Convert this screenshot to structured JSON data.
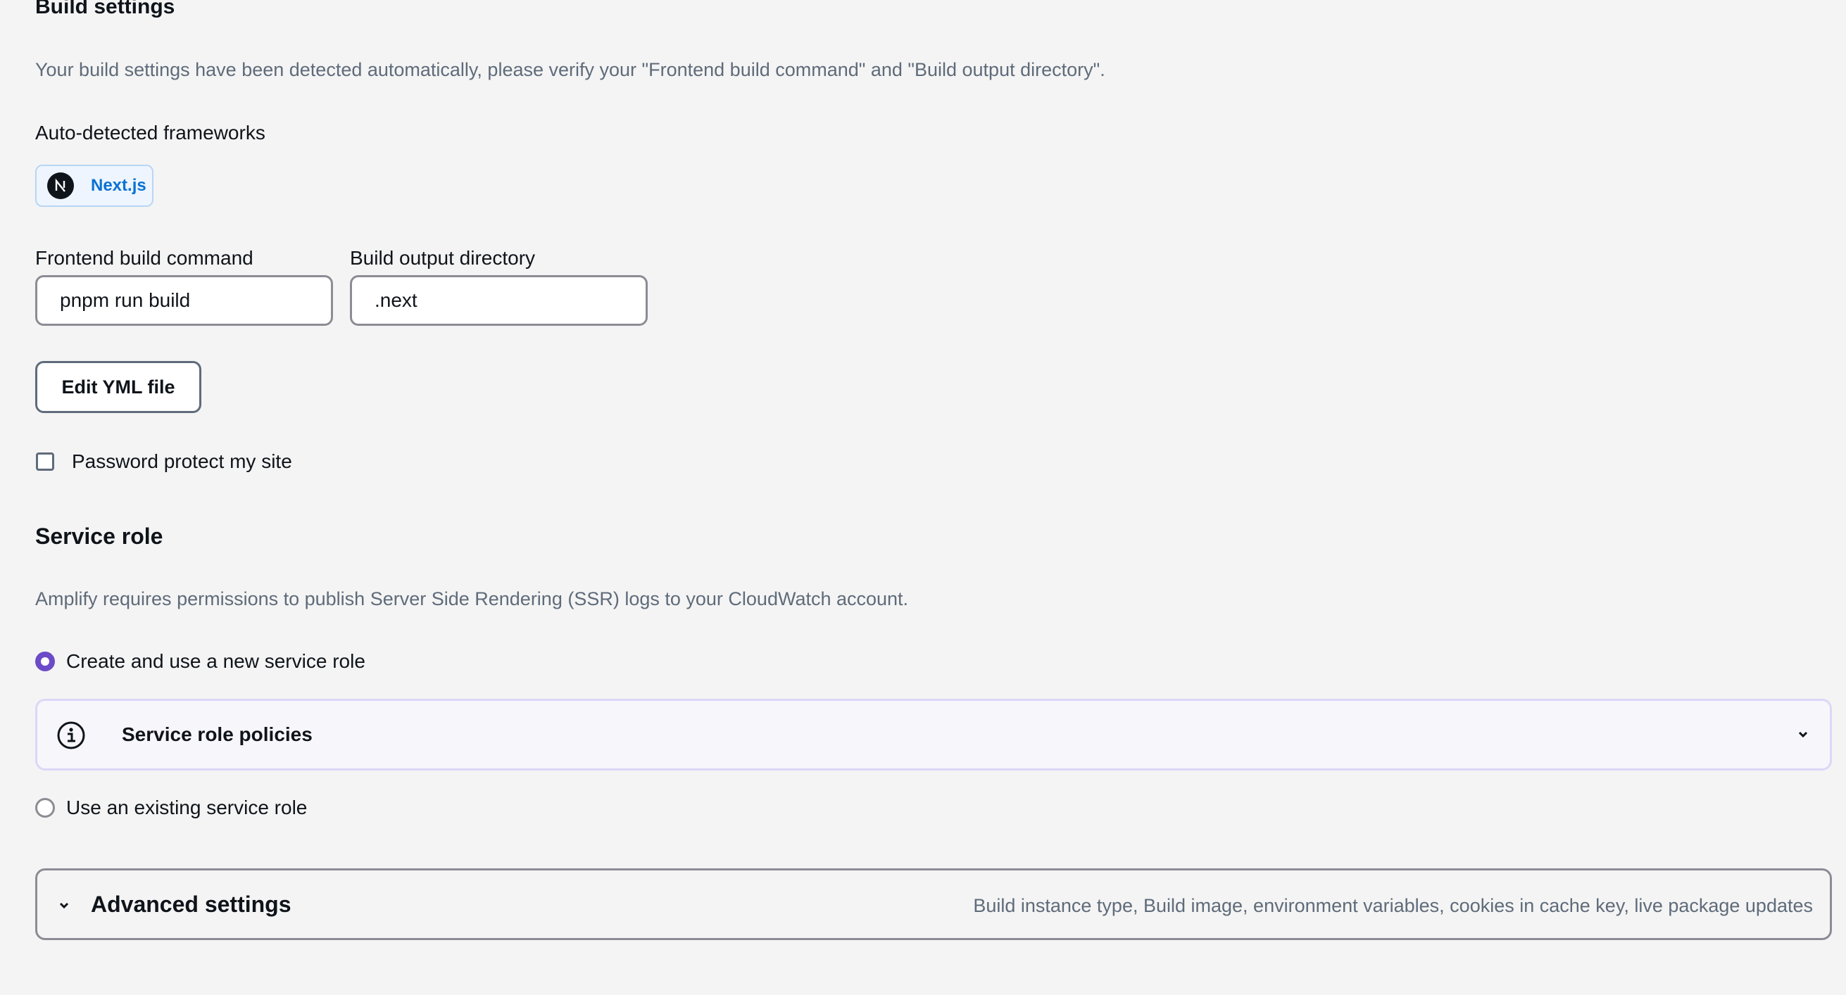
{
  "build_settings": {
    "title": "Build settings",
    "description": "Your build settings have been detected automatically, please verify your \"Frontend build command\" and \"Build output directory\".",
    "frameworks_label": "Auto-detected frameworks",
    "framework": {
      "name": "Next.js",
      "logo_letter": "N",
      "icon": "nextjs-logo-icon"
    },
    "frontend_build_command": {
      "label": "Frontend build command",
      "value": "pnpm run build"
    },
    "build_output_directory": {
      "label": "Build output directory",
      "value": ".next"
    },
    "edit_yml_label": "Edit YML file",
    "password_protect": {
      "label": "Password protect my site",
      "checked": false
    }
  },
  "service_role": {
    "title": "Service role",
    "description": "Amplify requires permissions to publish Server Side Rendering (SSR) logs to your CloudWatch account.",
    "options": [
      {
        "label": "Create and use a new service role",
        "selected": true
      },
      {
        "label": "Use an existing service role",
        "selected": false
      }
    ],
    "policies_panel": {
      "title": "Service role policies",
      "icon": "info-icon",
      "toggle_icon": "chevron-down-icon"
    }
  },
  "advanced_settings": {
    "title": "Advanced settings",
    "summary": "Build instance type, Build image, environment variables, cookies in cache key, live package updates",
    "toggle_icon": "chevron-down-icon"
  },
  "colors": {
    "page_background": "#f4f4f4",
    "primary_text": "#0f141a",
    "secondary_text": "#5f6b7a",
    "link_blue": "#0972d3",
    "radio_selected": "#6c4bc8",
    "chip_background": "#eef5fe",
    "chip_border": "#b8d6f5"
  }
}
